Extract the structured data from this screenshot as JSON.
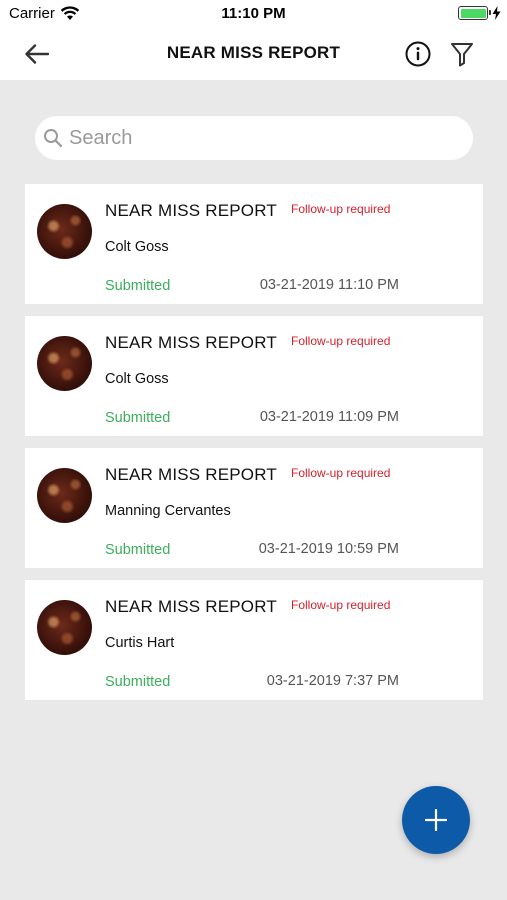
{
  "status_bar": {
    "carrier": "Carrier",
    "time": "11:10 PM",
    "icons": [
      "wifi-icon",
      "battery-icon",
      "charging-bolt-icon"
    ]
  },
  "header": {
    "title": "NEAR MISS REPORT",
    "icons": [
      "back-arrow-icon",
      "info-icon",
      "filter-icon"
    ]
  },
  "search": {
    "placeholder": "Search",
    "value": ""
  },
  "reports": [
    {
      "title": "NEAR MISS REPORT",
      "flag": "Follow-up required",
      "name": "Colt Goss",
      "status": "Submitted",
      "datetime": "03-21-2019 11:10 PM"
    },
    {
      "title": "NEAR MISS REPORT",
      "flag": "Follow-up required",
      "name": "Colt Goss",
      "status": "Submitted",
      "datetime": "03-21-2019 11:09 PM"
    },
    {
      "title": "NEAR MISS REPORT",
      "flag": "Follow-up required",
      "name": "Manning Cervantes",
      "status": "Submitted",
      "datetime": "03-21-2019 10:59 PM"
    },
    {
      "title": "NEAR MISS REPORT",
      "flag": "Follow-up required",
      "name": "Curtis Hart",
      "status": "Submitted",
      "datetime": "03-21-2019 7:37 PM"
    }
  ],
  "fab": {
    "icon": "plus-icon"
  },
  "colors": {
    "background": "#e9e9e9",
    "flag_red": "#d61f2c",
    "status_green": "#3cae5c",
    "fab_blue": "#0d5ba8",
    "battery_green": "#4cd964"
  }
}
